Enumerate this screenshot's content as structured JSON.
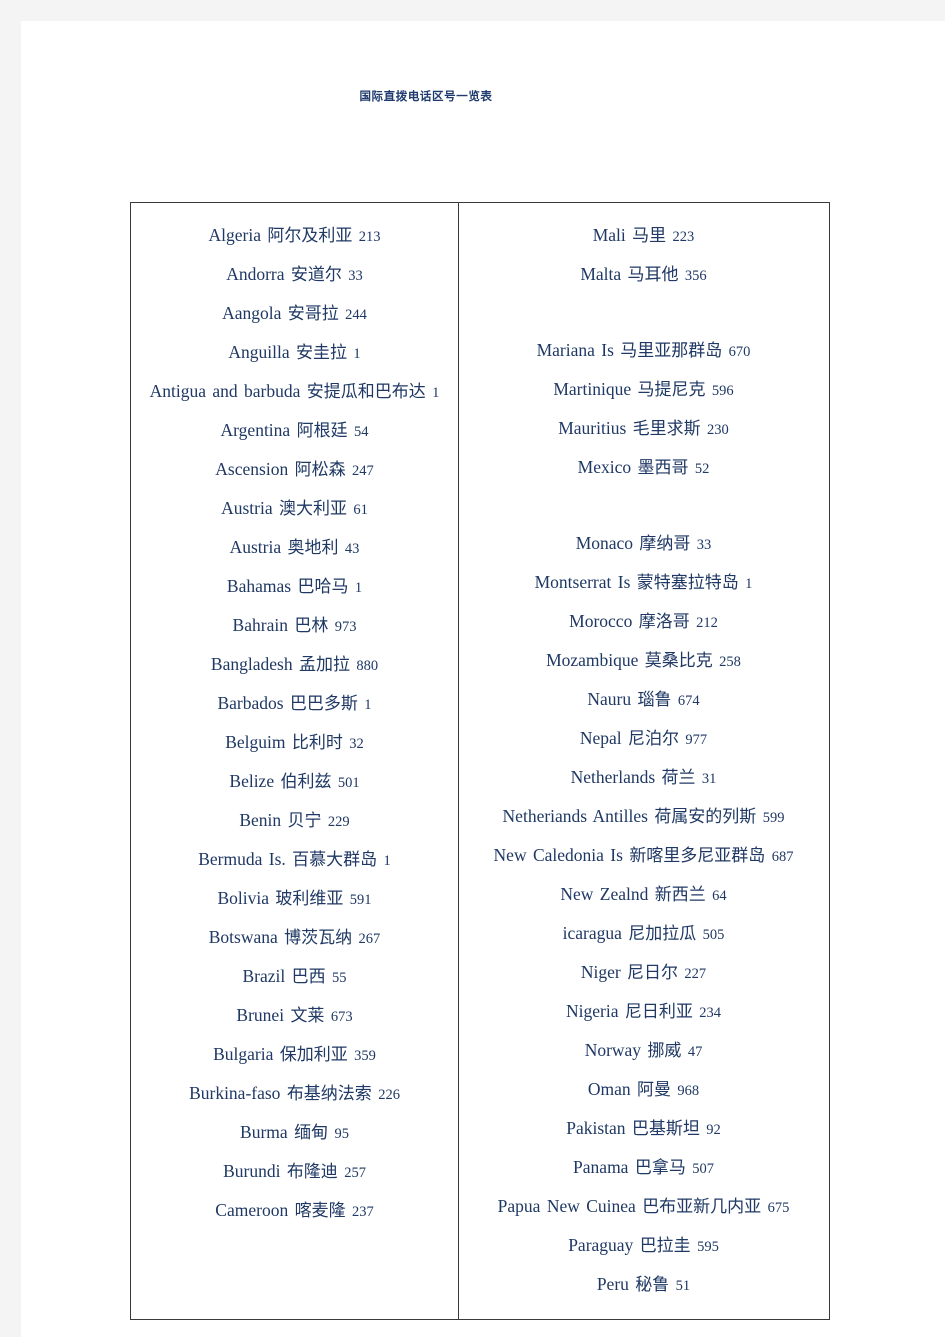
{
  "document": {
    "title": "国际直拨电话区号一览表",
    "title_color": "#1f3a6e",
    "text_color": "#1f3864",
    "page_background": "#ffffff",
    "canvas_background": "#f4f4f4",
    "border_color": "#3a3a3a"
  },
  "table": {
    "columns": [
      {
        "name": "left-column",
        "entries": [
          {
            "country": "Algeria",
            "cn": "阿尔及利亚",
            "code": "213"
          },
          {
            "country": "Andorra",
            "cn": "安道尔",
            "code": "33"
          },
          {
            "country": "Aangola",
            "cn": "安哥拉",
            "code": "244"
          },
          {
            "country": "Anguilla",
            "cn": "安圭拉",
            "code": "1"
          },
          {
            "country": "Antigua  and  barbuda",
            "cn": "安提瓜和巴布达",
            "code": "1"
          },
          {
            "country": "Argentina",
            "cn": "阿根廷",
            "code": "54"
          },
          {
            "country": "Ascension",
            "cn": "阿松森",
            "code": "247"
          },
          {
            "country": "Austria",
            "cn": "澳大利亚",
            "code": "61"
          },
          {
            "country": "Austria",
            "cn": "奥地利",
            "code": "43"
          },
          {
            "country": "Bahamas",
            "cn": "巴哈马",
            "code": "1"
          },
          {
            "country": "Bahrain",
            "cn": "巴林",
            "code": "973"
          },
          {
            "country": "Bangladesh",
            "cn": "孟加拉",
            "code": "880"
          },
          {
            "country": "Barbados",
            "cn": "巴巴多斯",
            "code": "1"
          },
          {
            "country": "Belguim",
            "cn": "比利时",
            "code": "32"
          },
          {
            "country": "Belize",
            "cn": "伯利兹",
            "code": "501"
          },
          {
            "country": "Benin",
            "cn": "贝宁",
            "code": "229"
          },
          {
            "country": "Bermuda  Is.",
            "cn": "百慕大群岛",
            "code": "1"
          },
          {
            "country": "Bolivia",
            "cn": "玻利维亚",
            "code": "591"
          },
          {
            "country": "Botswana",
            "cn": "博茨瓦纳",
            "code": "267"
          },
          {
            "country": "Brazil",
            "cn": "巴西",
            "code": "55"
          },
          {
            "country": "Brunei",
            "cn": "文莱",
            "code": "673"
          },
          {
            "country": "Bulgaria",
            "cn": "保加利亚",
            "code": "359"
          },
          {
            "country": "Burkina-faso",
            "cn": "布基纳法索",
            "code": "226"
          },
          {
            "country": "Burma",
            "cn": "缅甸",
            "code": "95"
          },
          {
            "country": "Burundi",
            "cn": "布隆迪",
            "code": "257"
          },
          {
            "country": "Cameroon",
            "cn": "喀麦隆",
            "code": "237"
          }
        ]
      },
      {
        "name": "right-column",
        "entries": [
          {
            "country": "Mali",
            "cn": "马里",
            "code": "223"
          },
          {
            "country": "Malta",
            "cn": "马耳他",
            "code": "356"
          },
          {
            "blank": true
          },
          {
            "country": "Mariana  Is",
            "cn": "马里亚那群岛",
            "code": "670"
          },
          {
            "country": "Martinique",
            "cn": "马提尼克",
            "code": "596"
          },
          {
            "country": "Mauritius",
            "cn": "毛里求斯",
            "code": "230"
          },
          {
            "country": "Mexico",
            "cn": "墨西哥",
            "code": "52"
          },
          {
            "blank": true
          },
          {
            "country": "Monaco",
            "cn": "摩纳哥",
            "code": "33"
          },
          {
            "country": "Montserrat  Is",
            "cn": "蒙特塞拉特岛",
            "code": "1"
          },
          {
            "country": "Morocco",
            "cn": "摩洛哥",
            "code": "212"
          },
          {
            "country": "Mozambique",
            "cn": "莫桑比克",
            "code": "258"
          },
          {
            "country": "Nauru",
            "cn": "瑙鲁",
            "code": "674"
          },
          {
            "country": "Nepal",
            "cn": "尼泊尔",
            "code": "977"
          },
          {
            "country": "Netherlands",
            "cn": "荷兰",
            "code": "31"
          },
          {
            "country": "Netheriands  Antilles",
            "cn": "荷属安的列斯",
            "code": "599"
          },
          {
            "country": "New  Caledonia  Is",
            "cn": "新喀里多尼亚群岛",
            "code": "687"
          },
          {
            "country": "New  Zealnd",
            "cn": "新西兰",
            "code": "64"
          },
          {
            "country": "icaragua",
            "cn": "尼加拉瓜",
            "code": "505"
          },
          {
            "country": "Niger",
            "cn": "尼日尔",
            "code": "227"
          },
          {
            "country": "Nigeria",
            "cn": "尼日利亚",
            "code": "234"
          },
          {
            "country": "Norway",
            "cn": "挪威",
            "code": "47"
          },
          {
            "country": "Oman",
            "cn": "阿曼",
            "code": "968"
          },
          {
            "country": "Pakistan",
            "cn": "巴基斯坦",
            "code": "92"
          },
          {
            "country": "Panama",
            "cn": "巴拿马",
            "code": "507"
          },
          {
            "country": "Papua  New  Cuinea",
            "cn": "巴布亚新几内亚",
            "code": "675"
          },
          {
            "country": "Paraguay",
            "cn": "巴拉圭",
            "code": "595"
          },
          {
            "country": "Peru",
            "cn": "秘鲁",
            "code": "51"
          }
        ]
      }
    ]
  }
}
